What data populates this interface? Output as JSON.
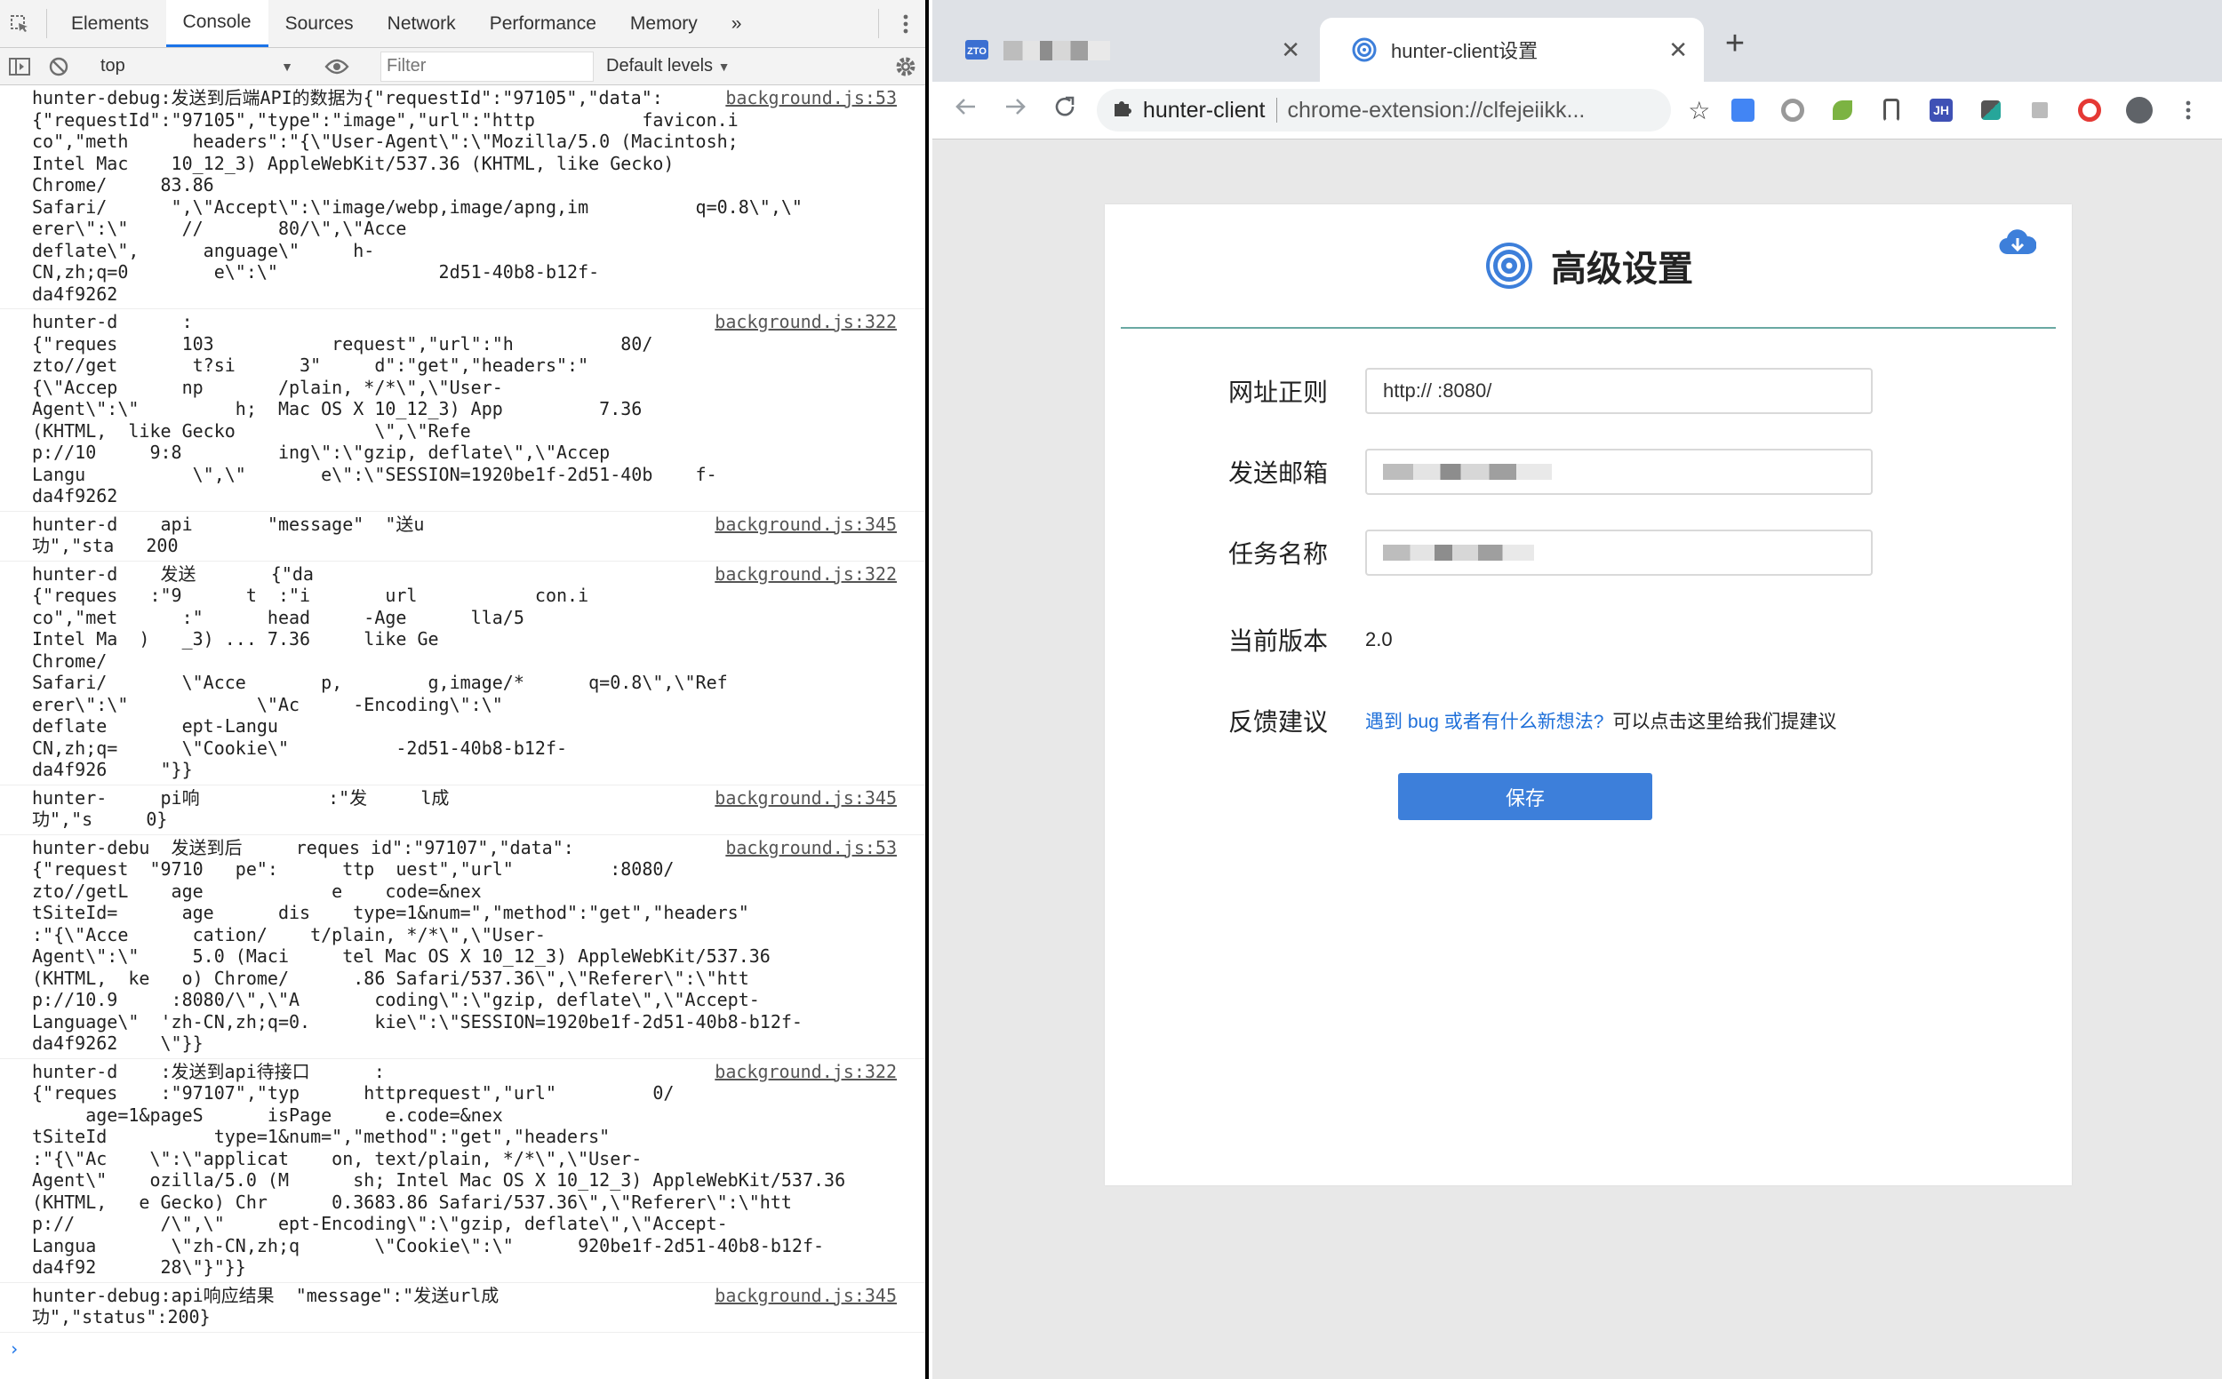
{
  "devtools": {
    "tabs": [
      "Elements",
      "Console",
      "Sources",
      "Network",
      "Performance",
      "Memory"
    ],
    "more_tabs": "»",
    "toolbar": {
      "context": "top",
      "filter_placeholder": "Filter",
      "levels": "Default levels"
    },
    "logs": [
      {
        "source": "background.js:53",
        "lines": [
          "hunter-debug:发送到后端API的数据为{\"requestId\":\"97105\",\"data\":",
          "{\"requestId\":\"97105\",\"type\":\"image\",\"url\":\"http          favicon.i",
          "co\",\"meth      headers\":\"{\\\"User-Agent\\\":\\\"Mozilla/5.0 (Macintosh;",
          "Intel Mac    10_12_3) AppleWebKit/537.36 (KHTML, like Gecko)",
          "Chrome/     83.86",
          "Safari/      \",\\\"Accept\\\":\\\"image/webp,image/apng,im          q=0.8\\\",\\\"",
          "erer\\\":\\\"     //       80/\\\",\\\"Acce",
          "deflate\\\",      anguage\\\"     h-",
          "CN,zh;q=0        e\\\":\\\"               2d51-40b8-b12f-",
          "da4f9262"
        ]
      },
      {
        "source": "background.js:322",
        "lines": [
          "hunter-d      :       ",
          "{\"reques      103           request\",\"url\":\"h          80/",
          "zto//get       t?si      3\"     d\":\"get\",\"headers\":\"",
          "{\\\"Accep      np       /plain, */*\\\",\\\"User-",
          "Agent\\\":\\\"         h;  Mac OS X 10_12_3) App         7.36",
          "(KHTML,  like Gecko             \\\",\\\"Refe",
          "p://10     9:8         ing\\\":\\\"gzip, deflate\\\",\\\"Accep",
          "Langu          \\\",\\\"       e\\\":\\\"SESSION=1920be1f-2d51-40b    f-",
          "da4f9262"
        ]
      },
      {
        "source": "background.js:345",
        "lines": [
          "hunter-d    api       \"message\"  \"送u",
          "功\",\"sta   200"
        ]
      },
      {
        "source": "background.js:322",
        "lines": [
          "hunter-d    发送       {\"da",
          "{\"reques   :\"9      t  :\"i       url           con.i",
          "co\",\"met      :\"      head     -Age      lla/5",
          "Intel Ma  )   _3) ... 7.36     like Ge",
          "Chrome/",
          "Safari/       \\\"Acce       p,        g,image/*      q=0.8\\\",\\\"Ref",
          "erer\\\":\\\"            \\\"Ac     -Encoding\\\":\\\"",
          "deflate       ept-Langu",
          "CN,zh;q=      \\\"Cookie\\\"          -2d51-40b8-b12f-",
          "da4f926     \"}}"
        ]
      },
      {
        "source": "background.js:345",
        "lines": [
          "hunter-     pi响            :\"发     l成",
          "功\",\"s     0}"
        ]
      },
      {
        "source": "background.js:53",
        "lines": [
          "hunter-debu  发送到后     reques id\":\"97107\",\"data\":",
          "{\"request  \"9710   pe\":      ttp  uest\",\"url\"         :8080/",
          "zto//getL    age            e    code=&nex",
          "tSiteId=      age      dis    type=1&num=\",\"method\":\"get\",\"headers\"",
          ":\"{\\\"Acce      cation/    t/plain, */*\\\",\\\"User-",
          "Agent\\\":\\\"     5.0 (Maci     tel Mac OS X 10_12_3) AppleWebKit/537.36",
          "(KHTML,  ke   o) Chrome/      .86 Safari/537.36\\\",\\\"Referer\\\":\\\"htt",
          "p://10.9     :8080/\\\",\\\"A       coding\\\":\\\"gzip, deflate\\\",\\\"Accept-",
          "Language\\\"  'zh-CN,zh;q=0.      kie\\\":\\\"SESSION=1920be1f-2d51-40b8-b12f-",
          "da4f9262    \\\"}}"
        ]
      },
      {
        "source": "background.js:322",
        "lines": [
          "hunter-d    :发送到api待接口      :",
          "{\"reques    :\"97107\",\"typ      httprequest\",\"url\"         0/",
          "     age=1&pageS      isPage     e.code=&nex",
          "tSiteId          type=1&num=\",\"method\":\"get\",\"headers\"",
          ":\"{\\\"Ac    \\\":\\\"applicat    on, text/plain, */*\\\",\\\"User-",
          "Agent\\\"    ozilla/5.0 (M      sh; Intel Mac OS X 10_12_3) AppleWebKit/537.36",
          "(KHTML,   e Gecko) Chr      0.3683.86 Safari/537.36\\\",\\\"Referer\\\":\\\"htt",
          "p://        /\\\",\\\"     ept-Encoding\\\":\\\"gzip, deflate\\\",\\\"Accept-",
          "Langua       \\\"zh-CN,zh;q       \\\"Cookie\\\":\\\"      920be1f-2d51-40b8-b12f-",
          "da4f92      28\\\"}\"}}"
        ]
      },
      {
        "source": "background.js:345",
        "lines": [
          "hunter-debug:api响应结果  \"message\":\"发送url成",
          "功\",\"status\":200}"
        ]
      }
    ],
    "prompt": "›"
  },
  "browser": {
    "tabs": [
      {
        "title": ""
      },
      {
        "title": "hunter-client设置"
      }
    ],
    "new_tab": "+",
    "address": {
      "host": "hunter-client",
      "url": "chrome-extension://clfejeiikk..."
    },
    "page": {
      "title": "高级设置",
      "fields": [
        {
          "label": "网址正则",
          "value": "http://      :8080/"
        },
        {
          "label": "发送邮箱",
          "value": ""
        },
        {
          "label": "任务名称",
          "value": ""
        }
      ],
      "version": {
        "label": "当前版本",
        "value": "2.0"
      },
      "feedback": {
        "label": "反馈建议",
        "link": "遇到 bug 或者有什么新想法?",
        "after": "可以点击这里给我们提建议"
      },
      "save_label": "保存"
    },
    "colors": {
      "accent": "#3d7fda",
      "divider": "#6aa9a3",
      "link": "#1e6fd9"
    }
  }
}
